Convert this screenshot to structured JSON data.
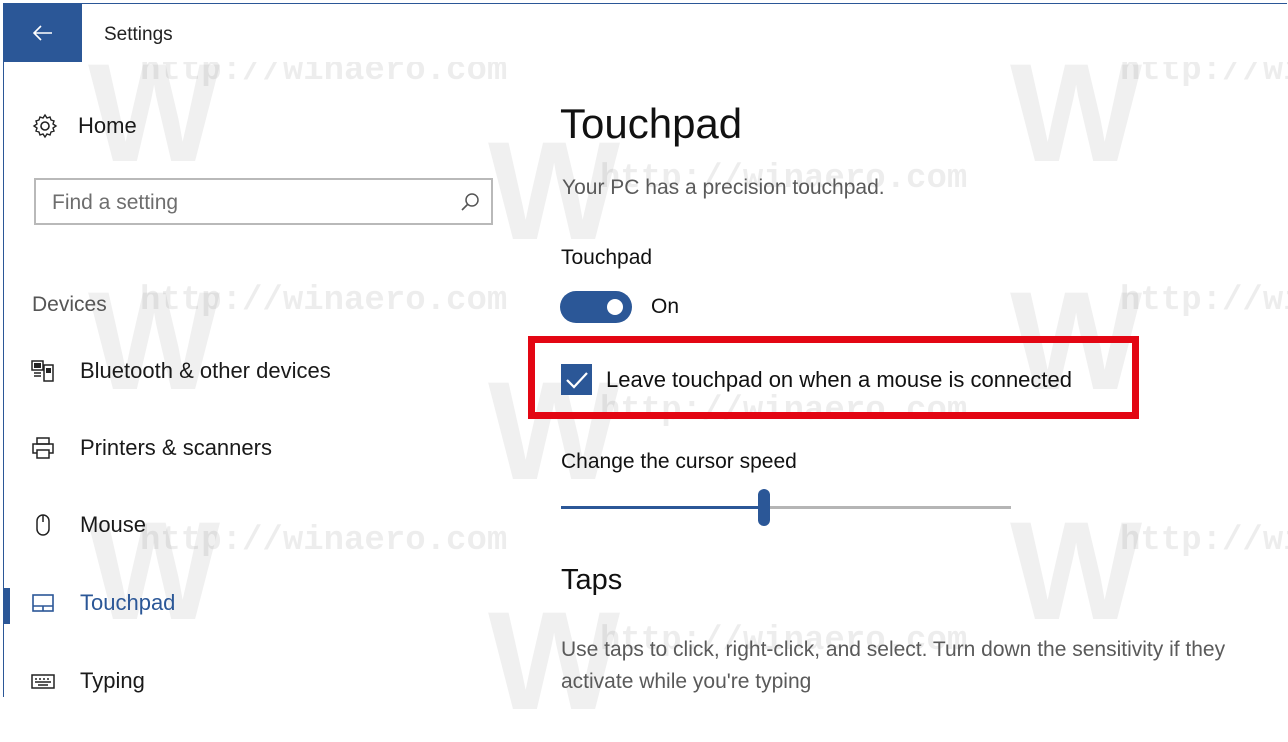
{
  "window": {
    "title": "Settings",
    "accent_color": "#2b5797",
    "back_icon": "back-arrow-icon"
  },
  "watermark": {
    "text": "http://winaero.com",
    "short_text": "http://wi",
    "logo_letter": "W"
  },
  "sidebar": {
    "home_label": "Home",
    "home_icon": "gear-icon",
    "search_placeholder": "Find a setting",
    "search_icon": "search-icon",
    "section_label": "Devices",
    "items": [
      {
        "label": "Bluetooth & other devices",
        "icon": "bluetooth-devices-icon",
        "active": false
      },
      {
        "label": "Printers & scanners",
        "icon": "printer-icon",
        "active": false
      },
      {
        "label": "Mouse",
        "icon": "mouse-icon",
        "active": false
      },
      {
        "label": "Touchpad",
        "icon": "touchpad-icon",
        "active": true
      },
      {
        "label": "Typing",
        "icon": "keyboard-icon",
        "active": false
      }
    ]
  },
  "main": {
    "page_title": "Touchpad",
    "description": "Your PC has a precision touchpad.",
    "touchpad_toggle": {
      "label": "Touchpad",
      "state_text": "On",
      "on": true
    },
    "leave_on_checkbox": {
      "label": "Leave touchpad on when a mouse is connected",
      "checked": true,
      "highlight_color": "#e30613"
    },
    "cursor_speed": {
      "label": "Change the cursor speed",
      "value_fraction": 0.45
    },
    "taps": {
      "heading": "Taps",
      "description": "Use taps to click, right-click, and select. Turn down the sensitivity if they activate while you're typing"
    }
  }
}
